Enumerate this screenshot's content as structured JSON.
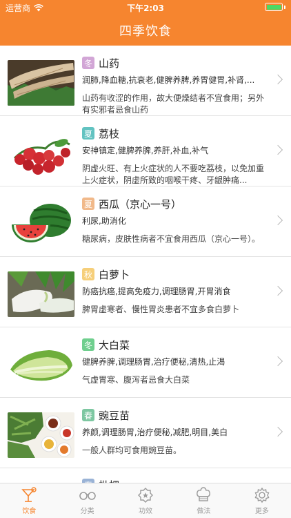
{
  "status_bar": {
    "carrier": "运营商",
    "time": "下午2:03"
  },
  "nav": {
    "title": "四季饮食"
  },
  "items": [
    {
      "season": "冬",
      "season_color": "#d2a6d6",
      "name": "山药",
      "effect": "润肺,降血糖,抗衰老,健脾养脾,养胃健胃,补肾,...",
      "caution": "山药有收涩的作用，故大便燥结者不宜食用；另外有实邪者忌食山药",
      "image": "yam-image"
    },
    {
      "season": "夏",
      "season_color": "#62c3c1",
      "name": "荔枝",
      "effect": "安神镇定,健脾养脾,养肝,补血,补气",
      "caution": "阴虚火旺、有上火症状的人不要吃荔枝，以免加重上火症状，阴虚所致的咽喉干疼、牙龈肿痛...",
      "image": "lychee-image"
    },
    {
      "season": "夏",
      "season_color": "#f1b98a",
      "name": "西瓜（京心一号）",
      "effect": "利尿,助消化",
      "caution": "糖尿病，皮肤性病者不宜食用西瓜（京心一号）。",
      "image": "watermelon-image"
    },
    {
      "season": "秋",
      "season_color": "#f6cf7a",
      "name": "白萝卜",
      "effect": "防癌抗癌,提高免疫力,调理肠胃,开胃消食",
      "caution": "脾胃虚寒者、慢性胃炎患者不宜多食白萝卜",
      "image": "radish-image"
    },
    {
      "season": "冬",
      "season_color": "#6fcf8e",
      "name": "大白菜",
      "effect": "健脾养脾,调理肠胃,治疗便秘,清热,止渴",
      "caution": "气虚胃寒、腹泻者忌食大白菜",
      "image": "cabbage-image"
    },
    {
      "season": "春",
      "season_color": "#7dc7a1",
      "name": "豌豆苗",
      "effect": "养颜,调理肠胃,治疗便秘,减肥,明目,美白",
      "caution": "一般人群均可食用豌豆苗。",
      "image": "pea-sprout-image"
    }
  ],
  "partial_item": {
    "season": "春",
    "season_color": "#9ab3d6",
    "name": "枇杷"
  },
  "tabs": [
    {
      "label": "饮食",
      "icon": "cocktail-icon",
      "active": true
    },
    {
      "label": "分类",
      "icon": "glasses-icon",
      "active": false
    },
    {
      "label": "功效",
      "icon": "star-badge-icon",
      "active": false
    },
    {
      "label": "做法",
      "icon": "chef-hat-icon",
      "active": false
    },
    {
      "label": "更多",
      "icon": "gear-icon",
      "active": false
    }
  ],
  "colors": {
    "brand_orange": "#f6852f",
    "battery_green": "#4cd964"
  }
}
